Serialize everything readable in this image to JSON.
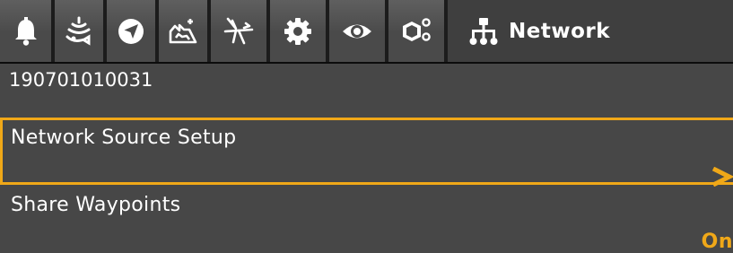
{
  "tabs": [
    {
      "icon": "bell-icon"
    },
    {
      "icon": "sonar-fish-icon"
    },
    {
      "icon": "navigation-compass-icon"
    },
    {
      "icon": "chart-contour-icon"
    },
    {
      "icon": "accessory-bird-icon"
    },
    {
      "icon": "gear-icon"
    },
    {
      "icon": "eye-icon"
    },
    {
      "icon": "accessories-blocks-icon"
    },
    {
      "icon": "network-icon",
      "label": "Network"
    }
  ],
  "device": {
    "serial": "190701010031"
  },
  "menu": {
    "items": [
      {
        "label": "Network Source Setup",
        "action_glyph": ">",
        "selected": true
      },
      {
        "label": "Share Waypoints",
        "value": "On"
      }
    ]
  },
  "colors": {
    "accent": "#f0a818",
    "panel": "#474747",
    "tab_bar": "#1c1c1c"
  }
}
